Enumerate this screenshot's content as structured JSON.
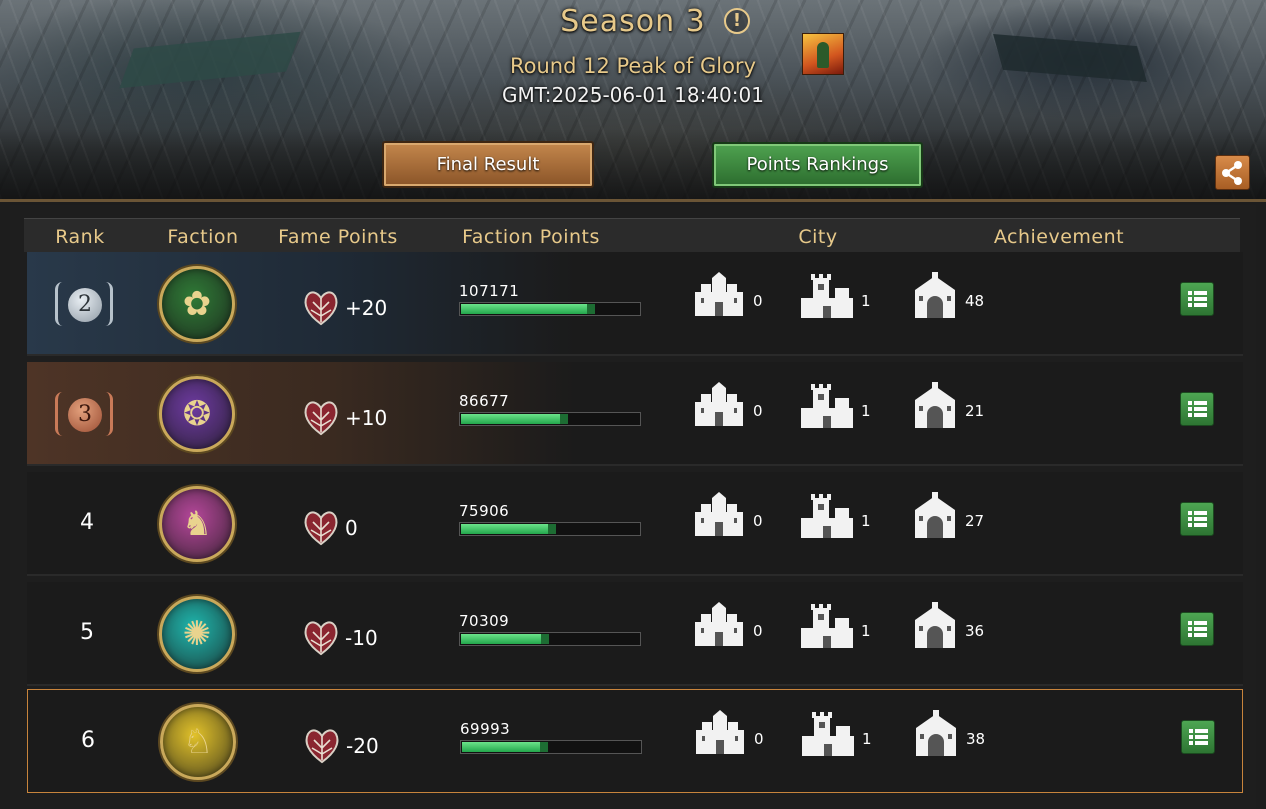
{
  "header": {
    "season_title": "Season 3",
    "round_title": "Round 12 Peak of Glory",
    "gmt": "GMT:2025-06-01 18:40:01",
    "final_result_label": "Final Result",
    "points_rankings_label": "Points Rankings"
  },
  "columns": {
    "rank": "Rank",
    "faction": "Faction",
    "fame_points": "Fame Points",
    "faction_points": "Faction Points",
    "city": "City",
    "achievement": "Achievement"
  },
  "rows": [
    {
      "rank": "2",
      "medal": "silver",
      "faction_color": "#2f7a36",
      "faction_icon": "rose-sigil-icon",
      "fame": "+20",
      "faction_points": "107171",
      "progress": 0.74,
      "city_small": "0",
      "city_medium": "1",
      "city_large": "48",
      "highlight": "silver"
    },
    {
      "rank": "3",
      "medal": "bronze",
      "faction_color": "#6d3aa0",
      "faction_icon": "dragon-sigil-icon",
      "fame": "+10",
      "faction_points": "86677",
      "progress": 0.58,
      "city_small": "0",
      "city_medium": "1",
      "city_large": "21",
      "highlight": "bronze"
    },
    {
      "rank": "4",
      "faction_color": "#b5479a",
      "faction_icon": "stag-sigil-icon",
      "fame": "0",
      "faction_points": "75906",
      "progress": 0.51,
      "city_small": "0",
      "city_medium": "1",
      "city_large": "27"
    },
    {
      "rank": "5",
      "faction_color": "#1fb6ad",
      "faction_icon": "kraken-sigil-icon",
      "fame": "-10",
      "faction_points": "70309",
      "progress": 0.47,
      "city_small": "0",
      "city_medium": "1",
      "city_large": "36"
    },
    {
      "rank": "6",
      "faction_color": "#e2c22a",
      "faction_icon": "wolf-sigil-icon",
      "fame": "-20",
      "faction_points": "69993",
      "progress": 0.46,
      "city_small": "0",
      "city_medium": "1",
      "city_large": "38",
      "highlight": "mine"
    }
  ],
  "colors": {
    "gold_text": "#e7c98a",
    "progress_green": "#23a74c",
    "own_row_border": "#c8843c"
  }
}
